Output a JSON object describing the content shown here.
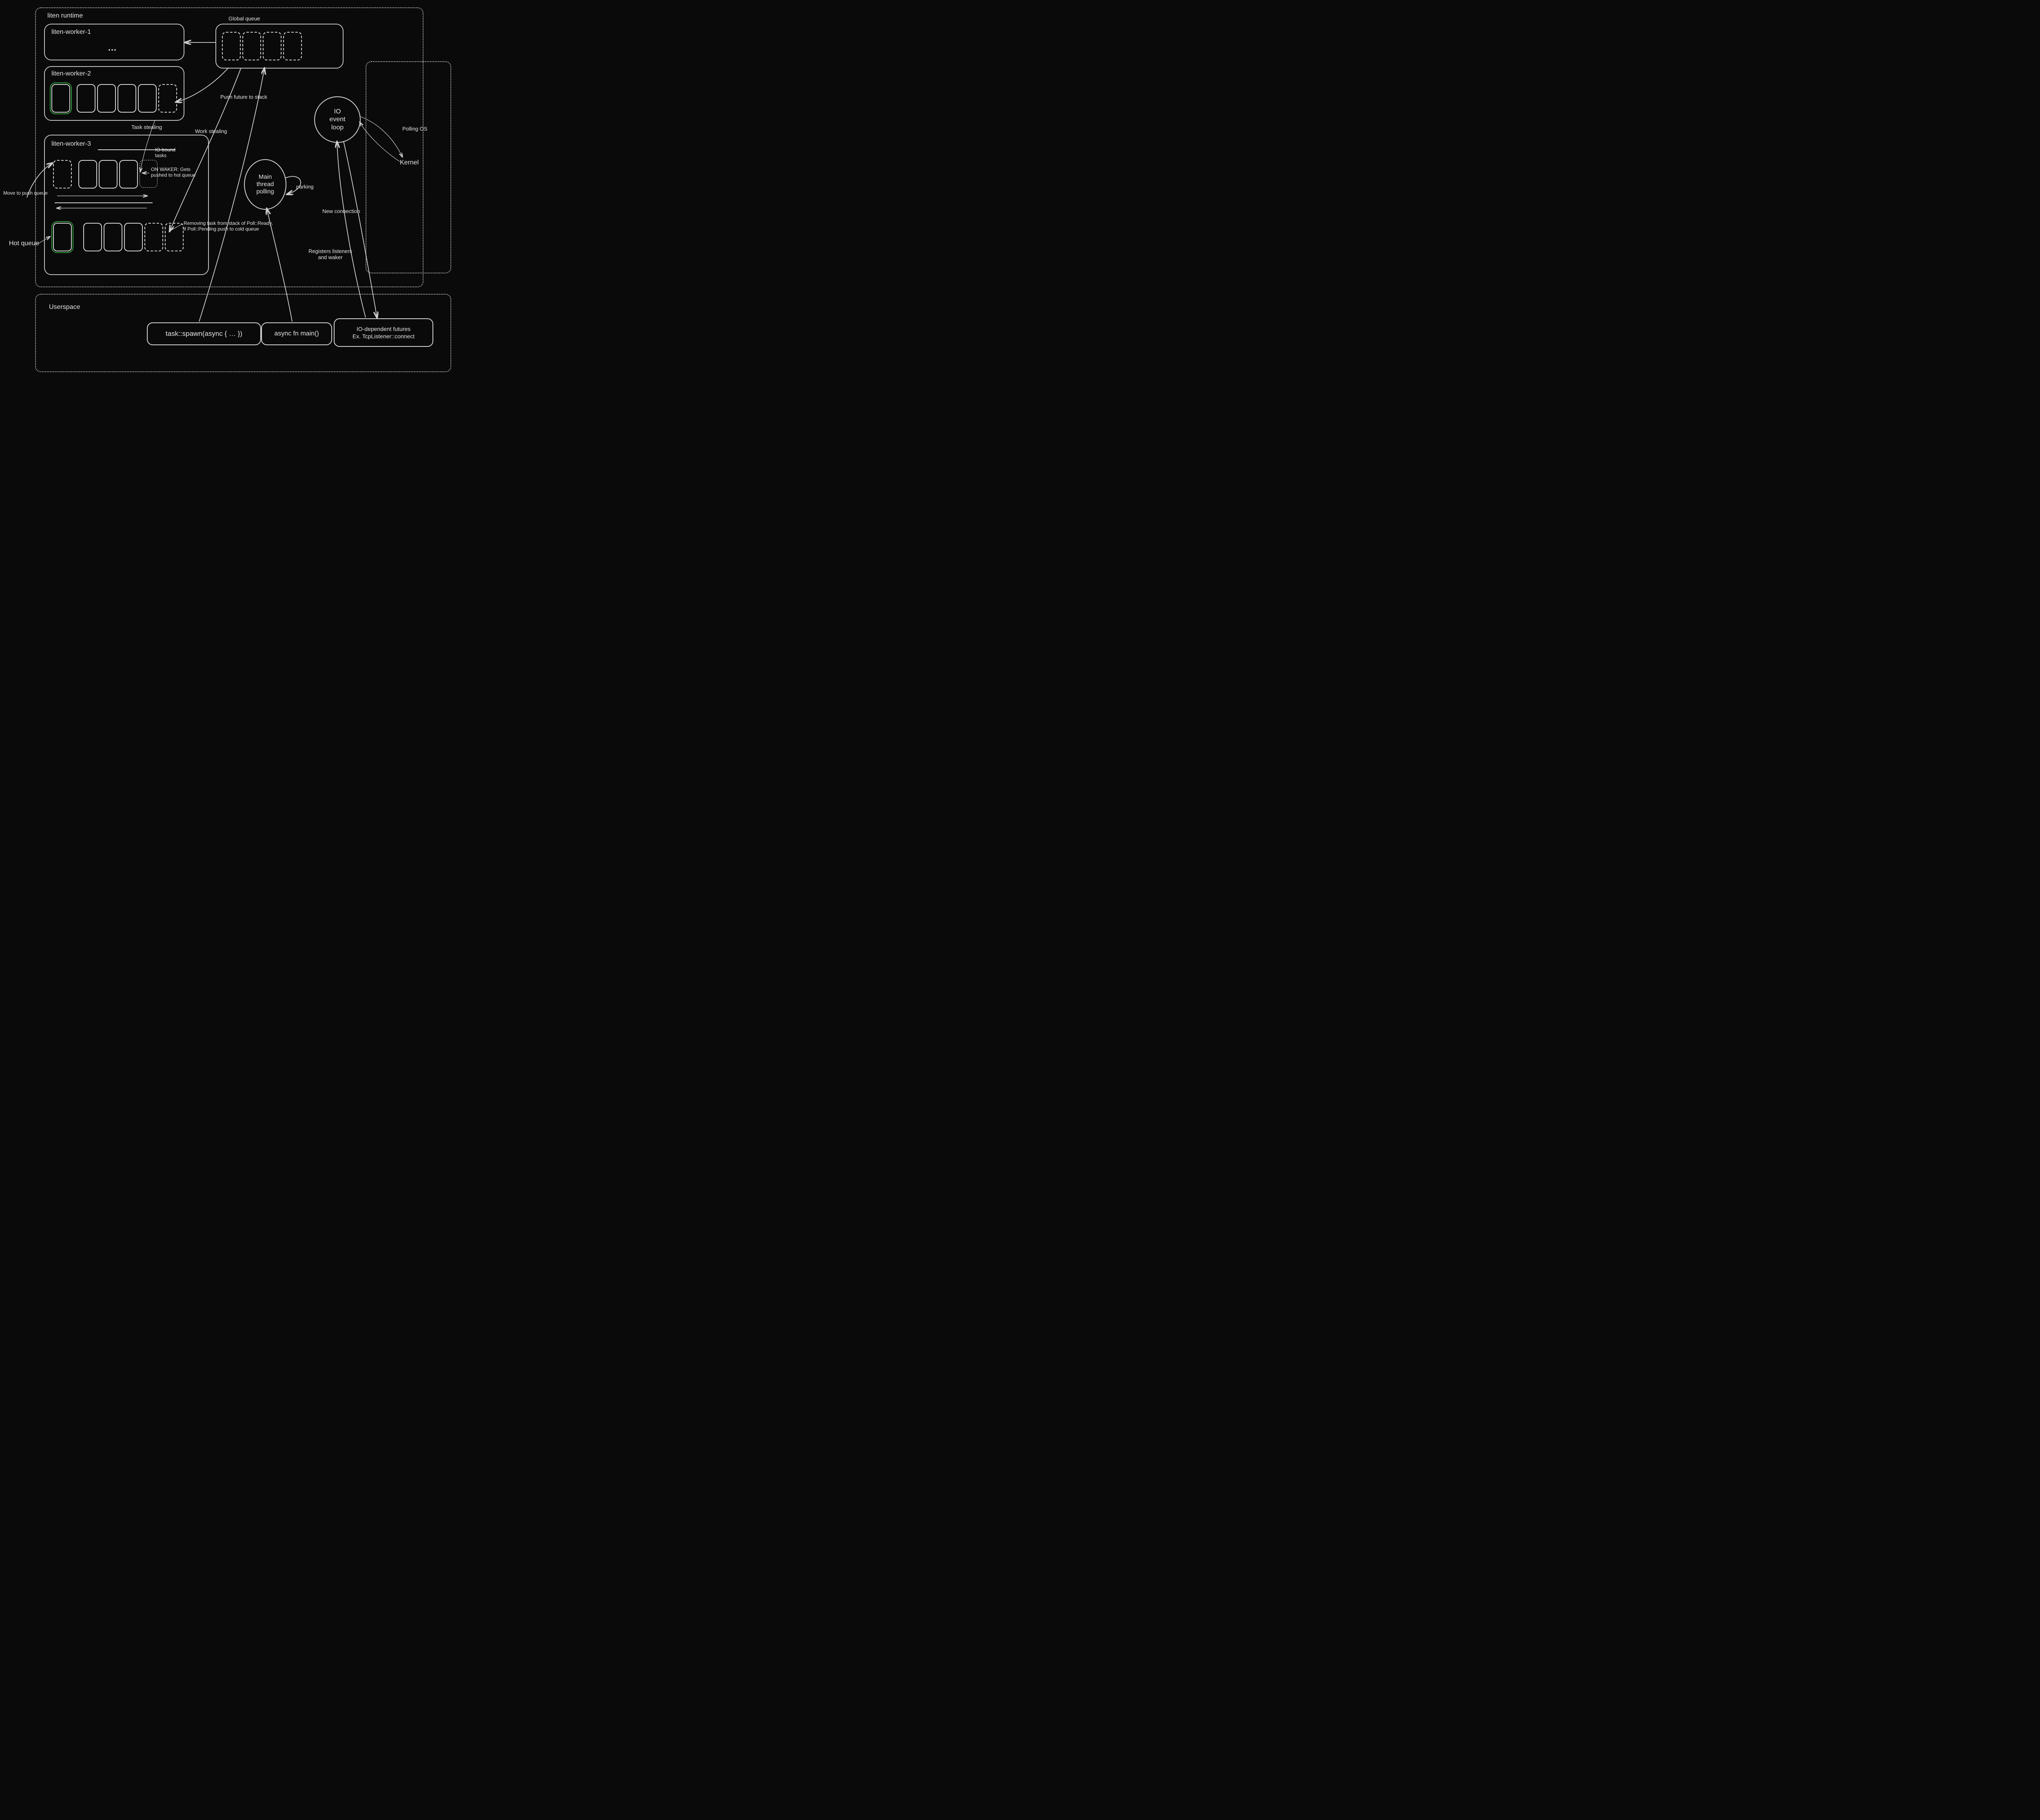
{
  "runtime": {
    "title": "liten runtime",
    "global_queue_label": "Global queue",
    "worker1": {
      "title": "liten-worker-1",
      "ellipsis": "…"
    },
    "worker2": {
      "title": "liten-worker-2"
    },
    "worker3": {
      "title": "liten-worker-3",
      "io_bound_label": "IO-bound\ntasks",
      "on_waker_label": "ON WAKER: Gets\npushed to hot queue",
      "removing_label": "Removing task from stack of Poll::Ready,\nif Poll::Pending push to cold queue"
    },
    "task_stealing_label": "Task stealing",
    "work_stealing_label": "Work stealing",
    "push_future_label": "Push future to stack",
    "move_to_push_label": "Move to push queue",
    "hot_queue_label": "Hot queue"
  },
  "io_loop": {
    "label": "IO\nevent\nloop"
  },
  "main_poll": {
    "label": "Main\nthread\npolling",
    "parking": "parking"
  },
  "registers_label": "Registers listeners\nand waker",
  "new_connection_label": "New connection",
  "polling_os_label": "Polling OS",
  "kernel_label": "Kernel",
  "userspace": {
    "title": "Userspace",
    "spawn": "task::spawn(async { … })",
    "main_fn": "async fn main()",
    "io_futures": "IO-dependent futures\nEx. TcpListener::connect"
  }
}
